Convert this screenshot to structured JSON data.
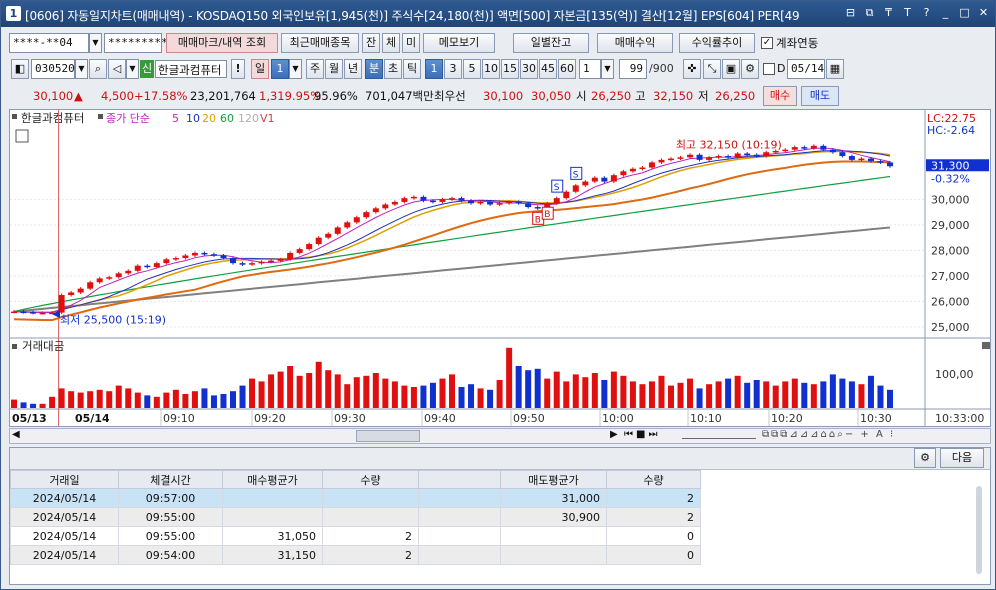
{
  "window": {
    "number": "1",
    "title": "[0606] 자동일지차트(매매내역) - KOSDAQ150 외국인보유[1,945(천)] 주식수[24,180(천)] 액면[500] 자본금[135(억)] 결산[12월] EPS[604] PER[49",
    "controls": [
      "⊟",
      "⧉",
      "₸",
      "T",
      "?",
      "_",
      "□",
      "✕"
    ]
  },
  "toolbar1": {
    "account": "****-**04",
    "password": "*********",
    "buttons": [
      "매매마크/내역 조회",
      "최근매매종목",
      "잔",
      "체",
      "미",
      "메모보기",
      "일별잔고",
      "매매수익",
      "수익률추이"
    ],
    "account_link_label": "계좌연동",
    "account_link_checked": true
  },
  "toolbar2": {
    "code": "030520",
    "stock_badge": "신",
    "stock_name": "한글과컴퓨터",
    "period_tabs": [
      "일",
      "1",
      "주",
      "월",
      "년",
      "분",
      "초",
      "틱"
    ],
    "active_period": "분",
    "intervals": [
      "1",
      "3",
      "5",
      "10",
      "15",
      "30",
      "45",
      "60"
    ],
    "active_interval": "1",
    "interval_value": "1",
    "count_value": "99",
    "count_total": "/900",
    "date_label": "D",
    "date_value": "05/14"
  },
  "quote": {
    "price": "30,100",
    "change_arrow": "▲",
    "change": "4,500",
    "change_rate": "+17.58%",
    "volume": "23,201,764",
    "volume_rate": "1,319.95%",
    "ratio": "95.96%",
    "trade_value": "701,047백만",
    "best_label": "최우선",
    "ask": "30,100",
    "bid": "30,050",
    "open_label": "시",
    "open": "26,250",
    "high_label": "고",
    "high": "32,150",
    "low_label": "저",
    "low": "26,250",
    "buy_label": "매수",
    "sell_label": "매도"
  },
  "chart_data": {
    "type": "candlestick",
    "stock": "한글과컴퓨터",
    "legend": [
      "종가 단순",
      "5",
      "10",
      "20",
      "60",
      "120",
      "V1"
    ],
    "legend_colors": [
      "#c020c0",
      "#c020c0",
      "#2030c0",
      "#e0a000",
      "#10a040",
      "#b0b0b0",
      "#d04040"
    ],
    "lc_label": "LC:22.75",
    "hc_label": "HC:-2.64",
    "current_price_label": "31,300",
    "current_change_label": "-0.32%",
    "y_ticks": [
      "25,000",
      "26,000",
      "27,000",
      "28,000",
      "29,000",
      "30,000",
      "31,300"
    ],
    "ylim": [
      24800,
      32800
    ],
    "x_ticks": [
      "05/13",
      "05/14",
      "09:10",
      "09:20",
      "09:30",
      "09:40",
      "09:50",
      "10:00",
      "10:10",
      "10:20",
      "10:30",
      "10:33:00"
    ],
    "annotation_high": "최고 32,150 (10:19)",
    "annotation_low": "최저 25,500 (15:19)",
    "trade_marks": [
      "S",
      "S",
      "B",
      "B"
    ],
    "candles_close": [
      25600,
      25580,
      25550,
      25550,
      25560,
      26250,
      26350,
      26500,
      26750,
      26900,
      26950,
      27100,
      27200,
      27400,
      27350,
      27500,
      27650,
      27700,
      27800,
      27900,
      27850,
      27800,
      27700,
      27500,
      27450,
      27500,
      27550,
      27600,
      27650,
      27900,
      28050,
      28250,
      28500,
      28650,
      28900,
      29100,
      29300,
      29500,
      29650,
      29800,
      29900,
      30050,
      30100,
      29950,
      29900,
      30000,
      30050,
      29950,
      29850,
      29900,
      29800,
      29850,
      29900,
      29850,
      29700,
      29650,
      29850,
      30050,
      30300,
      30550,
      30700,
      30850,
      30700,
      30950,
      31100,
      31200,
      31250,
      31450,
      31550,
      31600,
      31650,
      31750,
      31550,
      31650,
      31700,
      31650,
      31800,
      31750,
      31700,
      31850,
      31900,
      31950,
      32050,
      32000,
      32100,
      31950,
      31850,
      31700,
      31550,
      31600,
      31500,
      31450,
      31300
    ],
    "ma5_color": "#c020c0",
    "ma10_color": "#2030c0",
    "ma20_color": "#e0a000",
    "ma60_color": "#10a040",
    "ma120_color": "#808080",
    "volume_label": "거래대금",
    "volume_y_tick": "100,00",
    "volumes": [
      6,
      4,
      3,
      3,
      8,
      14,
      12,
      11,
      12,
      13,
      12,
      16,
      14,
      11,
      9,
      8,
      11,
      13,
      10,
      12,
      14,
      9,
      10,
      12,
      16,
      21,
      19,
      24,
      26,
      30,
      23,
      25,
      33,
      27,
      24,
      17,
      22,
      23,
      25,
      21,
      19,
      16,
      15,
      16,
      18,
      21,
      24,
      15,
      17,
      14,
      13,
      20,
      43,
      30,
      27,
      28,
      21,
      26,
      19,
      24,
      22,
      25,
      20,
      26,
      23,
      19,
      17,
      19,
      23,
      16,
      18,
      21,
      14,
      17,
      19,
      21,
      23,
      18,
      20,
      19,
      16,
      19,
      21,
      18,
      17,
      19,
      24,
      21,
      19,
      17,
      23,
      16,
      13
    ]
  },
  "grid": {
    "next_label": "다음",
    "columns": [
      "거래일",
      "체결시간",
      "매수평균가",
      "수량",
      "",
      "매도평균가",
      "수량"
    ],
    "rows": [
      {
        "date": "2024/05/14",
        "time": "09:57:00",
        "buy_avg": "",
        "buy_qty": "",
        "extra": "",
        "sell_avg": "31,000",
        "sell_qty": "2"
      },
      {
        "date": "2024/05/14",
        "time": "09:55:00",
        "buy_avg": "",
        "buy_qty": "",
        "extra": "",
        "sell_avg": "30,900",
        "sell_qty": "2"
      },
      {
        "date": "2024/05/14",
        "time": "09:55:00",
        "buy_avg": "31,050",
        "buy_qty": "2",
        "extra": "",
        "sell_avg": "",
        "sell_qty": "0"
      },
      {
        "date": "2024/05/14",
        "time": "09:54:00",
        "buy_avg": "31,150",
        "buy_qty": "2",
        "extra": "",
        "sell_avg": "",
        "sell_qty": "0"
      }
    ]
  }
}
